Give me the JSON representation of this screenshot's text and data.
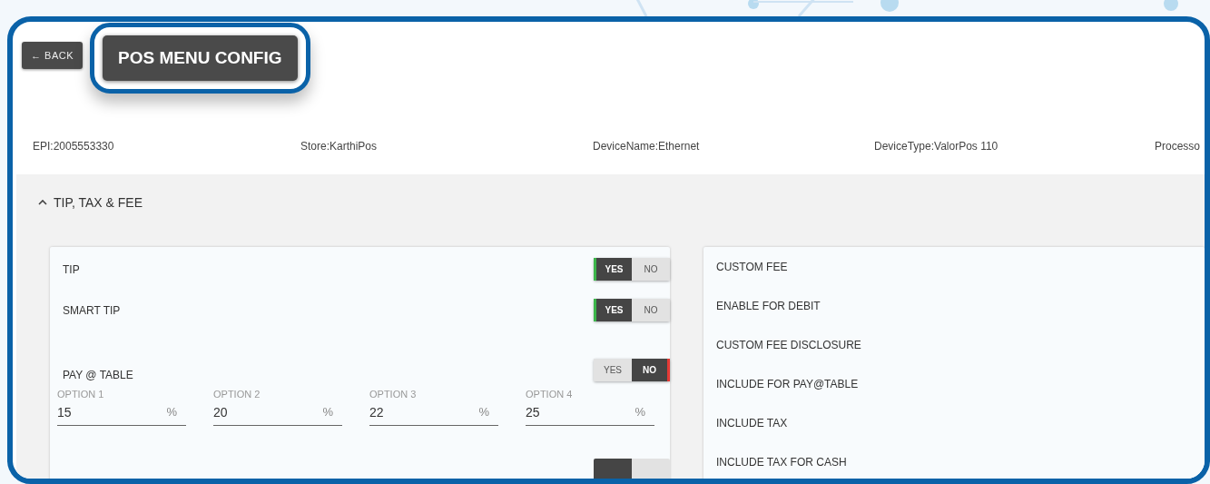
{
  "header": {
    "back_button": {
      "icon": "←",
      "label": "BACK"
    },
    "title_button": {
      "label": "POS MENU CONFIG",
      "highlighted": true
    }
  },
  "device_info": [
    "EPI:2005553330",
    "Store:KarthiPos",
    "DeviceName:Ethernet",
    "DeviceType:ValorPos 110",
    "Processo"
  ],
  "section": {
    "title": "TIP, TAX & FEE",
    "expanded": true
  },
  "left_panel": {
    "rows": [
      {
        "kind": "toggle",
        "label": "TIP",
        "options": [
          {
            "label": "YES",
            "selected": true
          },
          {
            "label": "NO",
            "selected": false
          }
        ]
      },
      {
        "kind": "toggle",
        "label": "SMART TIP",
        "options": [
          {
            "label": "YES",
            "selected": true
          },
          {
            "label": "NO",
            "selected": false
          }
        ]
      },
      {
        "kind": "toggle",
        "label": "PAY @ TABLE",
        "options": [
          {
            "label": "YES",
            "selected": false
          },
          {
            "label": "NO",
            "selected": true
          }
        ]
      },
      {
        "kind": "options",
        "fields": [
          {
            "label": "OPTION 1",
            "value": "15",
            "unit": "%"
          },
          {
            "label": "OPTION 2",
            "value": "20",
            "unit": "%"
          },
          {
            "label": "OPTION 3",
            "value": "22",
            "unit": "%"
          },
          {
            "label": "OPTION 4",
            "value": "25",
            "unit": "%"
          }
        ]
      },
      {
        "kind": "partial-toggle",
        "on": true
      }
    ]
  },
  "right_panel": {
    "rows": [
      "CUSTOM FEE",
      "ENABLE FOR DEBIT",
      "CUSTOM FEE DISCLOSURE",
      "INCLUDE FOR PAY@TABLE",
      "INCLUDE TAX",
      "INCLUDE TAX FOR CASH"
    ]
  }
}
